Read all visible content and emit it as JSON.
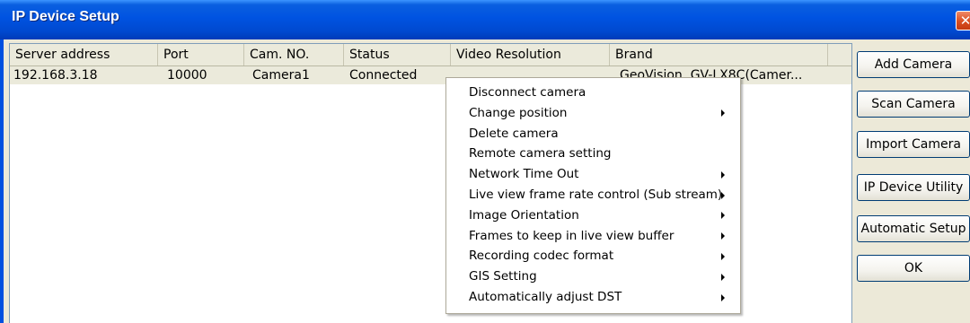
{
  "window": {
    "title": "IP Device Setup",
    "close_glyph": "✕"
  },
  "list": {
    "columns": [
      "Server address",
      "Port",
      "Cam. NO.",
      "Status",
      "Video Resolution",
      "Brand"
    ],
    "rows": [
      [
        "192.168.3.18",
        "10000",
        "Camera1",
        "Connected",
        "",
        "GeoVision, GV-LX8C(Camer..."
      ]
    ]
  },
  "buttons": [
    "Add Camera",
    "Scan Camera",
    "Import Camera",
    "IP Device Utility",
    "Automatic Setup",
    "OK"
  ],
  "context_menu": {
    "items": [
      {
        "label": "Disconnect camera",
        "submenu": false
      },
      {
        "label": "Change position",
        "submenu": true
      },
      {
        "label": "Delete camera",
        "submenu": false
      },
      {
        "label": "Remote camera setting",
        "submenu": false
      },
      {
        "label": "Network Time Out",
        "submenu": true
      },
      {
        "label": "Live view frame rate control (Sub stream)",
        "submenu": true
      },
      {
        "label": "Image Orientation",
        "submenu": true
      },
      {
        "label": "Frames to keep in live view buffer",
        "submenu": true
      },
      {
        "label": "Recording codec format",
        "submenu": true
      },
      {
        "label": "GIS Setting",
        "submenu": true
      },
      {
        "label": "Automatically adjust DST",
        "submenu": true
      }
    ]
  },
  "colors": {
    "titlebar": "#0053e1",
    "window_bg": "#ece9d8",
    "row_bg": "#ebeadb",
    "close_button": "#d94d1f"
  }
}
